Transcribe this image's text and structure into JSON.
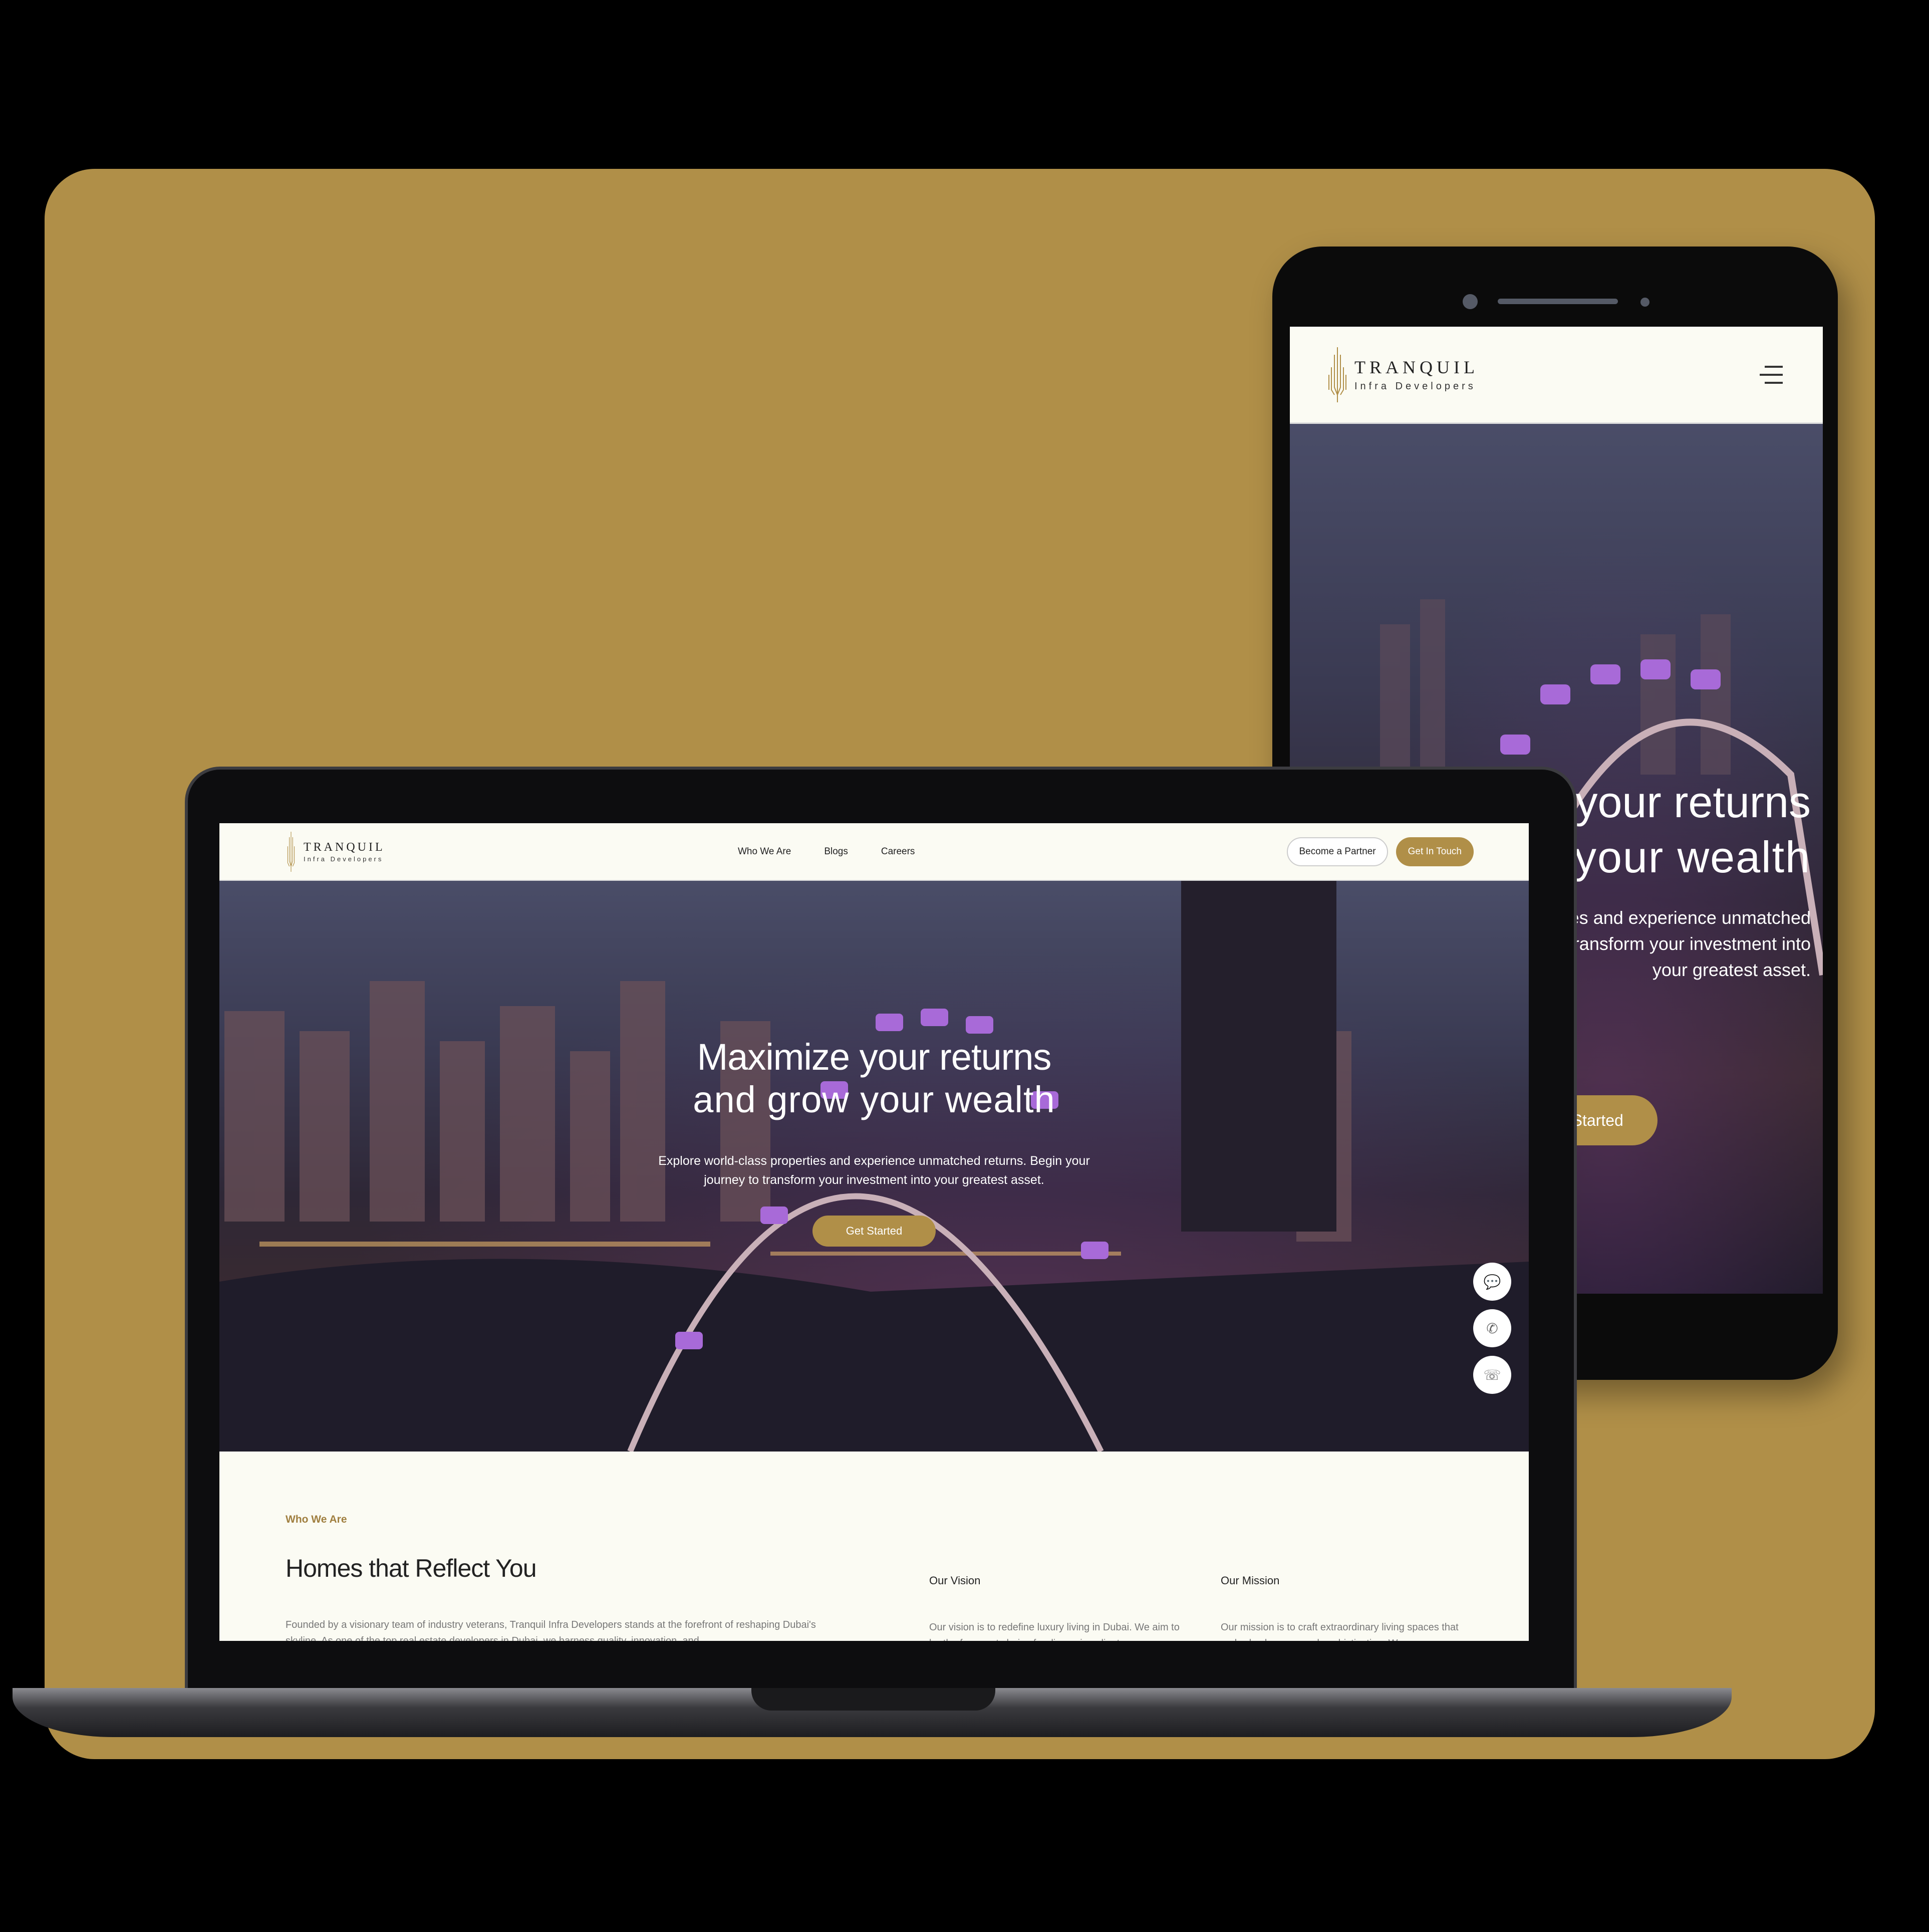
{
  "brand": {
    "name": "TRANQUIL",
    "tagline": "Infra Developers"
  },
  "colors": {
    "accent": "#b08f48",
    "background": "#fbfbf3"
  },
  "laptop": {
    "nav": {
      "links": [
        "Who We Are",
        "Blogs",
        "Careers"
      ],
      "partner_button": "Become a Partner",
      "contact_button": "Get In Touch"
    },
    "hero": {
      "title_line1": "Maximize your returns",
      "title_line2": "and grow your wealth",
      "description": "Explore world-class properties and experience unmatched returns. Begin your journey to transform your investment into your greatest asset.",
      "cta": "Get Started"
    },
    "floating_icons": [
      "chat-icon",
      "phone-icon",
      "whatsapp-icon"
    ],
    "about": {
      "eyebrow": "Who We Are",
      "title": "Homes that Reflect You",
      "text": "Founded by a visionary team of industry veterans, Tranquil Infra Developers stands at the forefront of reshaping Dubai's skyline. As one of the top real estate developers in Dubai, we harness quality, innovation, and",
      "vision": {
        "title": "Our Vision",
        "text": "Our vision is to redefine luxury living in Dubai. We aim to be the foremost choice for discerning clients"
      },
      "mission": {
        "title": "Our Mission",
        "text": "Our mission is to craft extraordinary living spaces that embody elegance and sophistication. We"
      }
    }
  },
  "phone": {
    "hero": {
      "title_line1": "Maximize your returns",
      "title_line2": "and grow your wealth",
      "description": "Explore world-class properties and experience unmatched returns. Begin your journey to transform your investment into your greatest asset.",
      "cta": "Get Started"
    }
  }
}
